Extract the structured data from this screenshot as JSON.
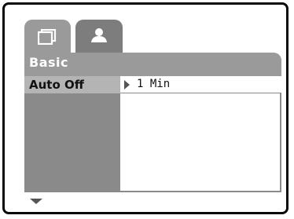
{
  "tabs": [
    {
      "icon": "display-icon"
    },
    {
      "icon": "person-icon"
    }
  ],
  "section": {
    "title": "Basic"
  },
  "menu": {
    "items": [
      {
        "label": "Auto Off",
        "value": "1 Min"
      }
    ]
  },
  "colors": {
    "tab_active": "#9a9a9a",
    "tab_inactive": "#7d7d7d",
    "panel": "#8a8a8a",
    "selected": "#b4b4b4",
    "text_light": "#ffffff",
    "text_dark": "#111111"
  }
}
